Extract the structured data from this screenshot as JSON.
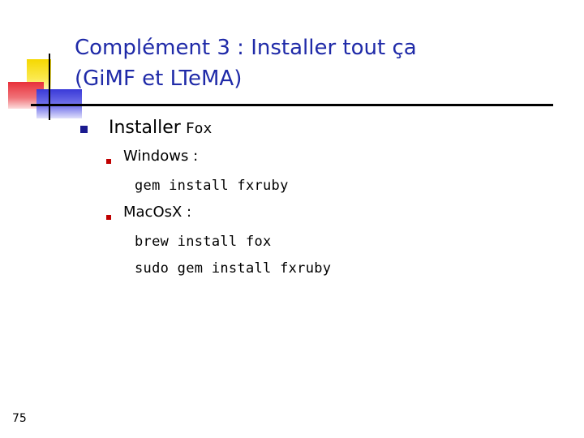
{
  "slide": {
    "title_line1": "Complément 3 : Installer tout ça",
    "title_line2": "(GiMF et LTeMA)",
    "bullet1": {
      "text": "Installer",
      "code": "Fox"
    },
    "sub_windows": {
      "label": "Windows :",
      "commands": [
        "gem install fxruby"
      ]
    },
    "sub_macosx": {
      "label": "MacOsX :",
      "commands": [
        "brew install fox",
        "sudo gem install fxruby"
      ]
    },
    "page_number": "75"
  },
  "colors": {
    "title": "#1f2aa8",
    "bullet_level1": "#1a1a8f",
    "bullet_level2": "#c00000",
    "deco_yellow": "#f5d800",
    "deco_red": "#e8303a",
    "deco_blue": "#3a3ad8"
  },
  "icons": {
    "decorative": "colored-squares-logo",
    "bullet_level1": "square-bullet",
    "bullet_level2": "square-bullet"
  }
}
